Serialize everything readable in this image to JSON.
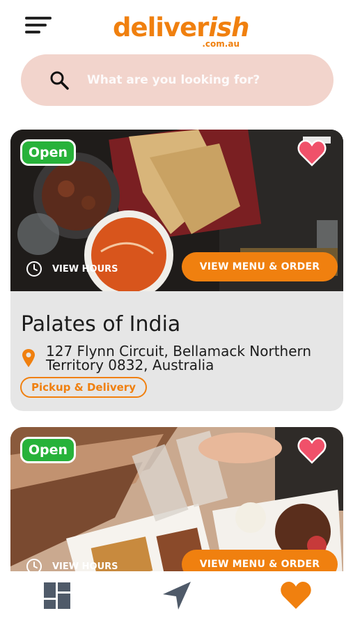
{
  "header": {
    "logo_main": "deliver",
    "logo_accent": "ish",
    "logo_sub": ".com.au",
    "menu_icon": "hamburger-menu-icon"
  },
  "search": {
    "placeholder": "What are you looking for?",
    "value": "",
    "icon": "search-icon"
  },
  "restaurants": [
    {
      "status": "Open",
      "hours_label": "VIEW HOURS",
      "action_label": "VIEW MENU & ORDER",
      "name": "Palates of India",
      "address": "127 Flynn Circuit, Bellamack Northern Territory 0832, Australia",
      "service": "Pickup & Delivery",
      "favorite": true
    },
    {
      "status": "Open",
      "hours_label": "VIEW HOURS",
      "action_label": "VIEW MENU & ORDER",
      "favorite": true
    }
  ],
  "tabbar": {
    "items": [
      {
        "icon": "dashboard-grid-icon",
        "active": false
      },
      {
        "icon": "navigation-arrow-icon",
        "active": false
      },
      {
        "icon": "heart-icon",
        "active": true
      }
    ]
  },
  "colors": {
    "brand": "#f0800f",
    "open_badge": "#27b23a",
    "favorite": "#f0516a",
    "search_bg": "#f2d4cc",
    "card_bg": "#e6e6e6"
  }
}
